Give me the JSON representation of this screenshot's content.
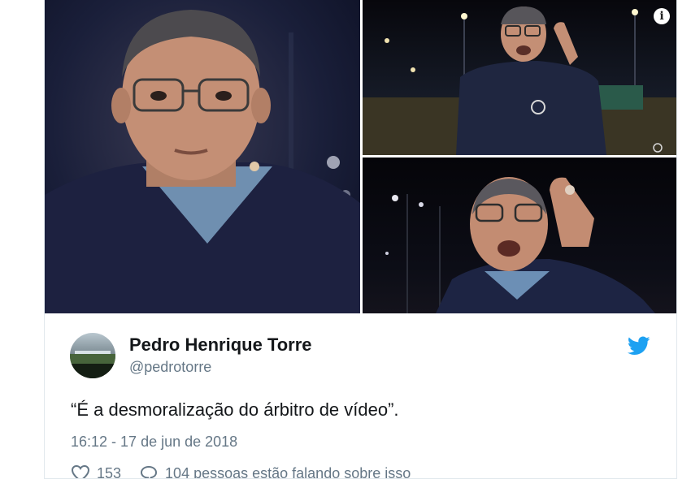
{
  "media": {
    "images": [
      {
        "name": "main-photo"
      },
      {
        "name": "top-right-photo"
      },
      {
        "name": "bottom-right-photo"
      }
    ],
    "info_icon_glyph": "i"
  },
  "tweet": {
    "author_name": "Pedro Henrique Torre",
    "author_handle": "@pedrotorre",
    "text": "“É a desmoralização do árbitro de vídeo”.",
    "timestamp": "16:12 - 17 de jun de 2018",
    "like_count": "153",
    "reply_text": "104 pessoas estão falando sobre isso",
    "brand_icon": "twitter-bird-icon",
    "brand_color": "#1da1f2"
  }
}
